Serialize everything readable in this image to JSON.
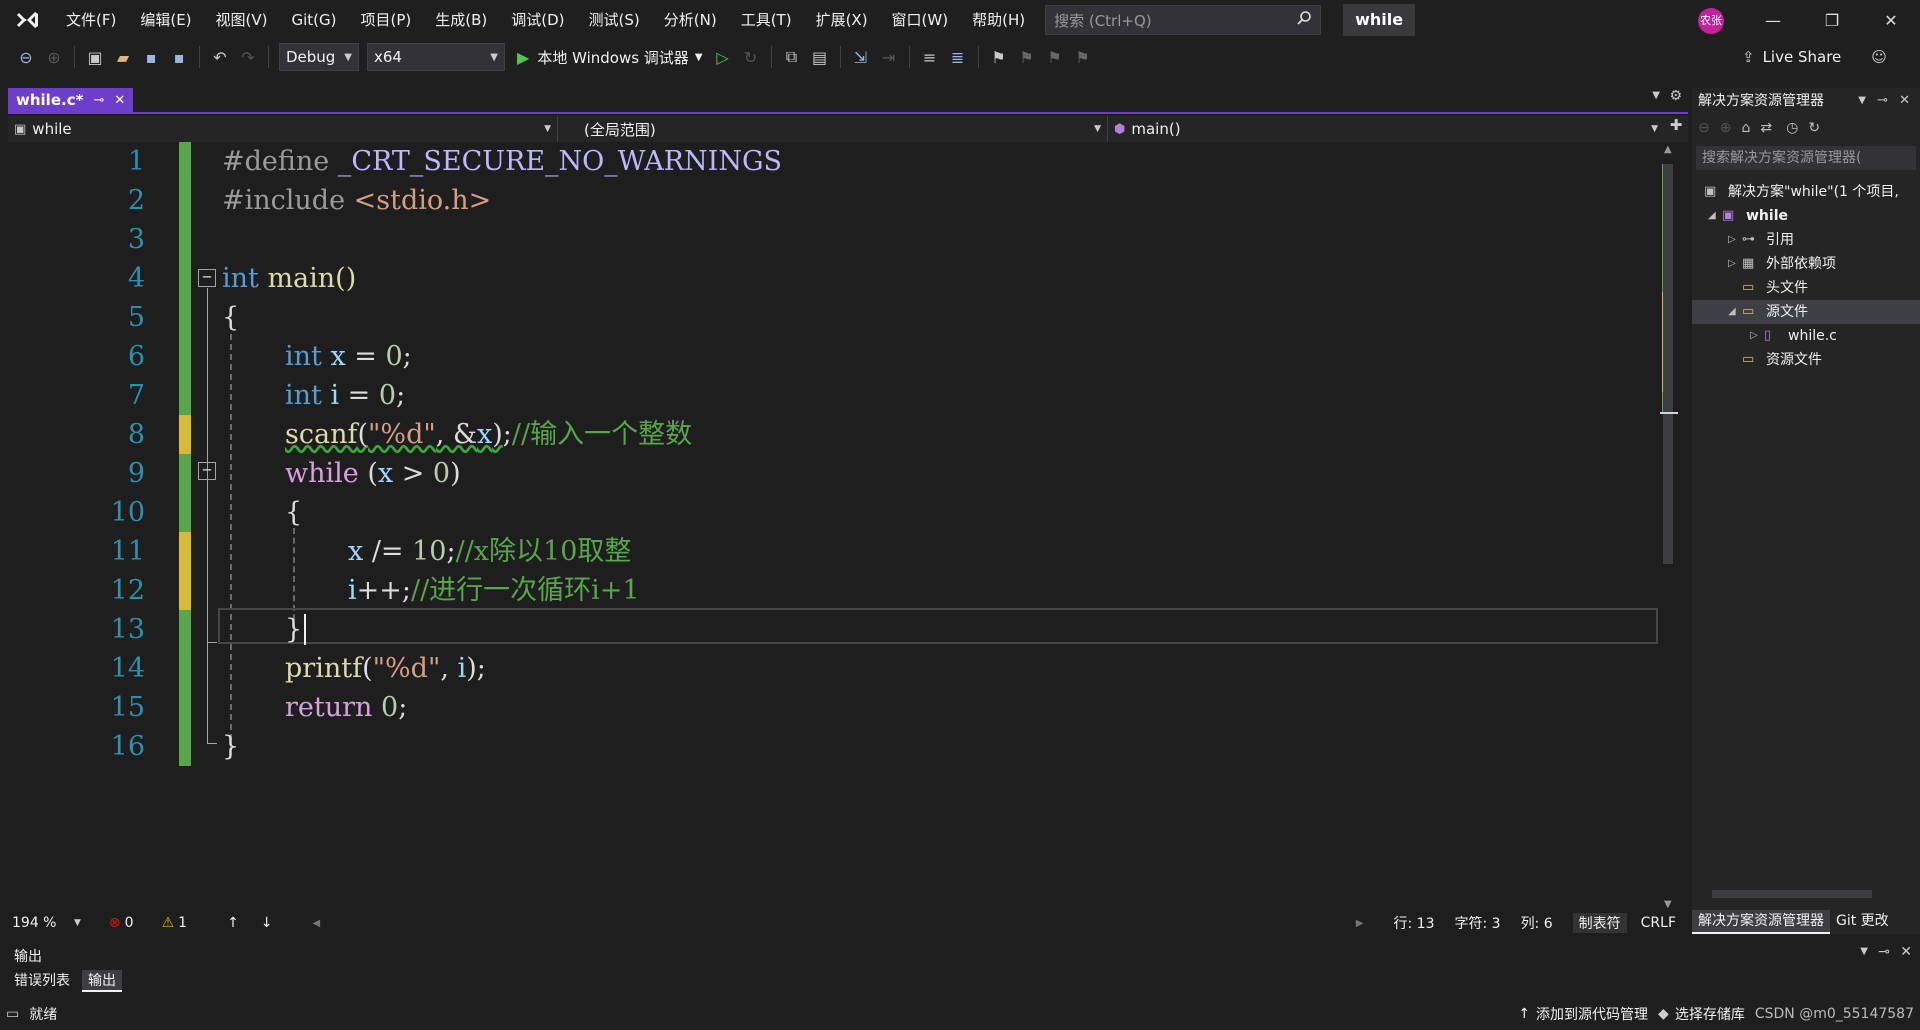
{
  "titlebar": {
    "menus": [
      "文件(F)",
      "编辑(E)",
      "视图(V)",
      "Git(G)",
      "项目(P)",
      "生成(B)",
      "调试(D)",
      "测试(S)",
      "分析(N)",
      "工具(T)",
      "扩展(X)",
      "窗口(W)",
      "帮助(H)"
    ],
    "search_placeholder": "搜索 (Ctrl+Q)",
    "solution_name": "while",
    "avatar_text": "农张",
    "minimize": "—",
    "restore": "❐",
    "close": "✕"
  },
  "toolbar": {
    "config": "Debug",
    "platform": "x64",
    "run_label": "本地 Windows 调试器",
    "liveshare": "Live Share"
  },
  "editor": {
    "tab_title": "while.c*",
    "nav_project": "while",
    "nav_scope": "(全局范围)",
    "nav_member": "main()",
    "line_numbers": [
      "1",
      "2",
      "3",
      "4",
      "5",
      "6",
      "7",
      "8",
      "9",
      "10",
      "11",
      "12",
      "13",
      "14",
      "15",
      "16"
    ],
    "lines": {
      "l1_kw": "#define",
      "l1_macro": " _CRT_SECURE_NO_WARNINGS",
      "l2_kw": "#include",
      "l2_str": " <stdio.h>",
      "l4_kw": "int",
      "l4_rest": " main()",
      "l5": "{",
      "l6_kw": "int",
      "l6_id": " x",
      "l6_rest": " = ",
      "l6_num": "0",
      "l6_end": ";",
      "l7_kw": "int",
      "l7_id": " i",
      "l7_rest": " = ",
      "l7_num": "0",
      "l7_end": ";",
      "l8_fn": "scanf",
      "l8_p1": "(",
      "l8_str": "\"%d\"",
      "l8_p2": ", &",
      "l8_id": "x",
      "l8_p3": ")",
      "l8_end": ";",
      "l8_cmt": "//输入一个整数",
      "l9_kw": "while",
      "l9_p1": " (",
      "l9_id": "x",
      "l9_p2": " > ",
      "l9_num": "0",
      "l9_p3": ")",
      "l10": "{",
      "l11_id": "x",
      "l11_p": " /= ",
      "l11_num": "10",
      "l11_end": ";",
      "l11_cmt": "//x除以10取整",
      "l12_id": "i",
      "l12_p": "++;",
      "l12_cmt": "//进行一次循环i+1",
      "l13": "}",
      "l14_fn": "printf",
      "l14_p1": "(",
      "l14_str": "\"%d\"",
      "l14_p2": ", ",
      "l14_id": "i",
      "l14_p3": ");",
      "l15_kw": "return",
      "l15_sp": " ",
      "l15_num": "0",
      "l15_end": ";",
      "l16": "}"
    },
    "zoom": "194 %",
    "errors": "0",
    "warnings": "1",
    "pos_line": "行: 13",
    "pos_char": "字符: 3",
    "pos_col": "列: 6",
    "tabs_mode": "制表符",
    "eol": "CRLF"
  },
  "output_panel": {
    "title": "输出",
    "tabs": [
      "错误列表",
      "输出"
    ]
  },
  "solution_explorer": {
    "title": "解决方案资源管理器",
    "search_placeholder": "搜索解决方案资源管理器(",
    "tree": [
      {
        "label": "解决方案\"while\"(1 个项目,",
        "arrow": ""
      },
      {
        "label": "while",
        "arrow": "◢"
      },
      {
        "label": "引用",
        "arrow": "▷"
      },
      {
        "label": "外部依赖项",
        "arrow": "▷"
      },
      {
        "label": "头文件",
        "arrow": ""
      },
      {
        "label": "源文件",
        "arrow": "◢"
      },
      {
        "label": "while.c",
        "arrow": "▷"
      },
      {
        "label": "资源文件",
        "arrow": ""
      }
    ],
    "bottom_tabs": [
      "解决方案资源管理器",
      "Git 更改"
    ]
  },
  "statusbar": {
    "ready": "就绪",
    "add_source": "添加到源代码管理",
    "select_repo": "选择存储库",
    "watermark": "CSDN @m0_55147587"
  },
  "colors": {
    "accent": "#6c3ec9",
    "change_saved": "#57a64a",
    "change_unsaved": "#d7ba36"
  }
}
